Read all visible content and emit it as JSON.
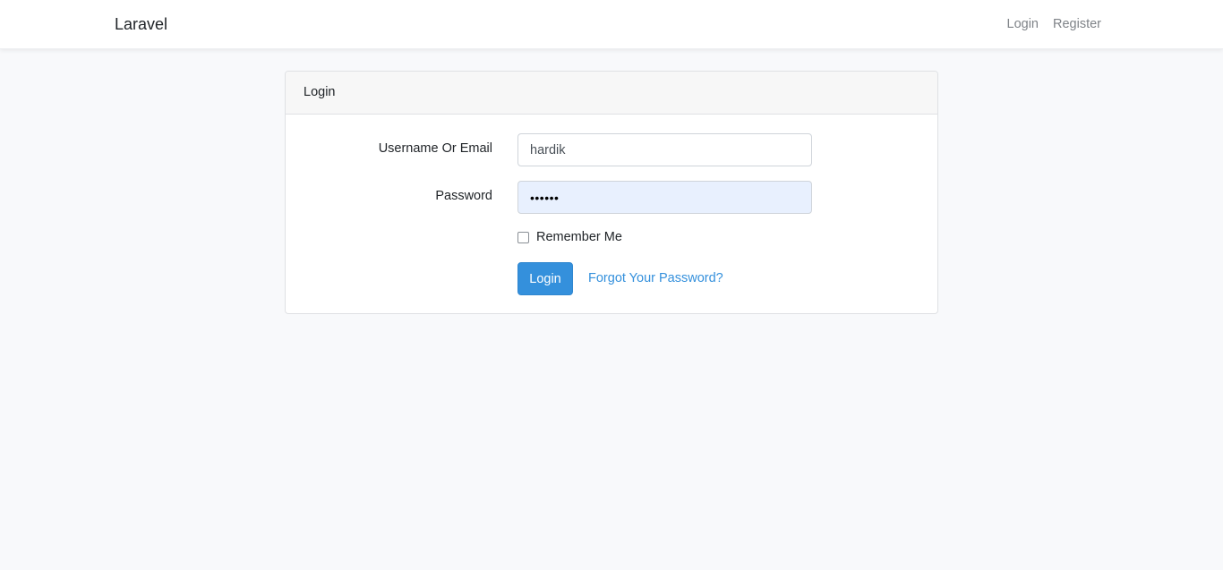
{
  "navbar": {
    "brand": "Laravel",
    "links": [
      {
        "label": "Login"
      },
      {
        "label": "Register"
      }
    ]
  },
  "card": {
    "header": "Login",
    "fields": {
      "username": {
        "label": "Username Or Email",
        "value": "hardik"
      },
      "password": {
        "label": "Password",
        "value": "••••••"
      }
    },
    "remember_label": "Remember Me",
    "remember_checked": false,
    "submit_label": "Login",
    "forgot_label": "Forgot Your Password?"
  },
  "colors": {
    "primary": "#3490dc",
    "background": "#f8f9fb",
    "autofill": "#e8f0fe"
  }
}
